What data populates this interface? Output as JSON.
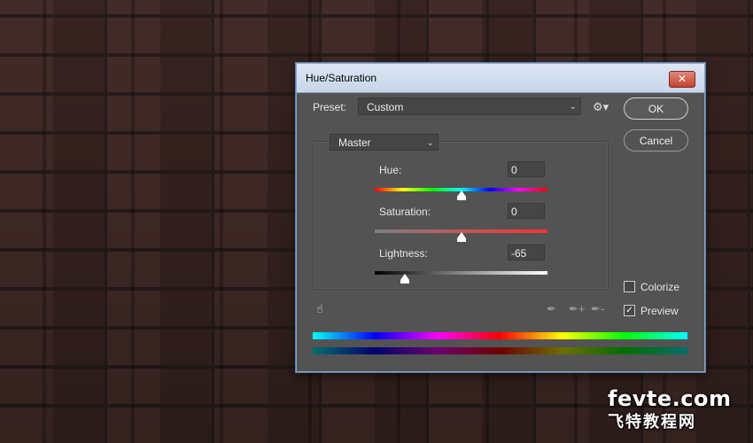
{
  "dialog": {
    "title": "Hue/Saturation",
    "close_label": "✕"
  },
  "preset": {
    "label": "Preset:",
    "value": "Custom"
  },
  "buttons": {
    "ok": "OK",
    "cancel": "Cancel"
  },
  "channel": {
    "value": "Master"
  },
  "sliders": {
    "hue": {
      "label": "Hue:",
      "value": "0",
      "position": 0.5
    },
    "saturation": {
      "label": "Saturation:",
      "value": "0",
      "position": 0.5
    },
    "lightness": {
      "label": "Lightness:",
      "value": "-65",
      "position": 0.175
    }
  },
  "options": {
    "colorize": {
      "label": "Colorize",
      "checked": false
    },
    "preview": {
      "label": "Preview",
      "checked": true
    }
  },
  "icons": {
    "gear": "gear-icon",
    "hand": "targeted-adjustment-icon",
    "eyedropper": "eyedropper-icon",
    "eyedropper_add": "eyedropper-plus-icon",
    "eyedropper_sub": "eyedropper-minus-icon"
  },
  "watermark": {
    "line1": "fevte.com",
    "line2": "飞特教程网"
  }
}
